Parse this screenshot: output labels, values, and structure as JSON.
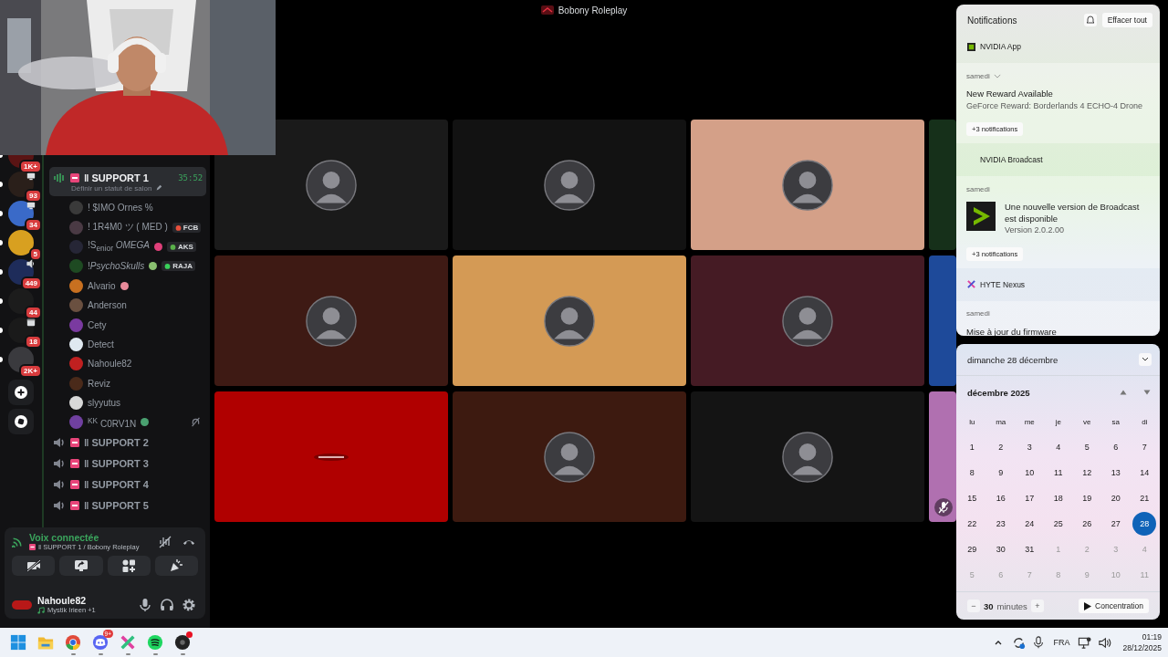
{
  "window": {
    "title": "Bobony Roleplay"
  },
  "servers": [
    {
      "badge": "1K+",
      "unread": true,
      "color": "#5a1414"
    },
    {
      "badge": "93",
      "unread": true,
      "color": "#2a1f1a",
      "activity": {
        "kind": "screen"
      }
    },
    {
      "badge": "34",
      "unread": true,
      "color": "#3a6ac8",
      "activity": {
        "kind": "screen"
      }
    },
    {
      "badge": "5",
      "unread": true,
      "color": "#d8a020"
    },
    {
      "badge": "449",
      "unread": true,
      "color": "#1e2c5a",
      "activity": {
        "kind": "voice"
      }
    },
    {
      "badge": "44",
      "unread": true,
      "color": "#1c1c1c"
    },
    {
      "badge": "18",
      "unread": true,
      "color": "#1a1a1a",
      "activity": {
        "kind": "event"
      }
    },
    {
      "badge": "2K+",
      "unread": true,
      "color": "#3a3a3e"
    }
  ],
  "channels": [
    {
      "name": "ǁ SUPPORT 1",
      "selected": true,
      "timer": "35:52",
      "status": "Définir un statut de salon",
      "members": [
        {
          "name": "! $IMO Ornes %",
          "color": "#3a3a3a",
          "deafened": false
        },
        {
          "name": "! 1R4M0 ツ ( MED )",
          "color": "#4a3a44",
          "deafened": false,
          "tag": {
            "label": "FCB",
            "color": "#e8503c"
          }
        },
        {
          "name": "!S$_{enior}$ *OMEGA*",
          "color": "#262636",
          "deafened": false,
          "emoji": {
            "kind": "question"
          },
          "tag": {
            "label": "AKS",
            "color": "#5ab04a"
          }
        },
        {
          "name": "!*PsychoSkulls*",
          "color": "#1e4a22",
          "deafened": false,
          "emoji": {
            "kind": "alien"
          },
          "tag": {
            "label": "RAJA",
            "color": "#3ad05a"
          }
        },
        {
          "name": "Alvario",
          "color": "#c87020",
          "deafened": false,
          "emoji": {
            "kind": "pig"
          }
        },
        {
          "name": "Anderson",
          "color": "#6a5040",
          "deafened": false
        },
        {
          "name": "Cety",
          "color": "#7a3aa0",
          "deafened": false
        },
        {
          "name": "Detect",
          "color": "#dfe8f0",
          "deafened": false
        },
        {
          "name": "Nahoule82",
          "color": "#c02020",
          "deafened": false
        },
        {
          "name": "Reviz",
          "color": "#4a2a1a",
          "deafened": false
        },
        {
          "name": "slyyutus",
          "color": "#d8d8d8",
          "deafened": false
        },
        {
          "name": "$^{KK}$ C0RV1N",
          "color": "#7040a0",
          "deafened": true,
          "emoji": {
            "kind": "dragon"
          }
        }
      ]
    },
    {
      "name": "ǁ SUPPORT 2",
      "selected": false
    },
    {
      "name": "ǁ SUPPORT 3",
      "selected": false
    },
    {
      "name": "ǁ SUPPORT 4",
      "selected": false
    },
    {
      "name": "ǁ SUPPORT 5",
      "selected": false
    }
  ],
  "voice": {
    "status": "Voix connectée",
    "channel": "ǁ SUPPORT 1 / Bobony Roleplay"
  },
  "user": {
    "name": "Nahoule82",
    "activity": "Mystik Irieen +1"
  },
  "tiles": [
    {
      "color": "#1a1a1a",
      "kind": "avatar",
      "muted": false
    },
    {
      "color": "#121212",
      "kind": "avatar",
      "muted": false
    },
    {
      "color": "#d4a088",
      "kind": "avatar",
      "muted": false
    },
    {
      "color": "#16301a",
      "kind": "blank",
      "muted": false
    },
    {
      "color": "#3e1a14",
      "kind": "avatar",
      "muted": false
    },
    {
      "color": "#d49a55",
      "kind": "avatar",
      "muted": false
    },
    {
      "color": "#451b24",
      "kind": "avatar",
      "muted": false
    },
    {
      "color": "#1e4a9a",
      "kind": "blank",
      "muted": false
    },
    {
      "color": "#b00000",
      "kind": "logo",
      "muted": false
    },
    {
      "color": "#3d1a10",
      "kind": "avatar",
      "muted": false
    },
    {
      "color": "#141414",
      "kind": "avatar",
      "muted": false
    },
    {
      "color": "#b070b0",
      "kind": "blank",
      "muted": true
    }
  ],
  "notifications": {
    "title": "Notifications",
    "clear": "Effacer tout",
    "groups": [
      {
        "app": "NVIDIA App",
        "kind": "nvidia",
        "items": [
          {
            "day": "samedi",
            "expandable": true,
            "title": "New Reward Available",
            "body": "GeForce Reward: Borderlands 4 ECHO-4 Drone",
            "image": false
          }
        ],
        "more": "+3 notifications"
      },
      {
        "app": "NVIDIA Broadcast",
        "kind": "broadcast",
        "items": [
          {
            "day": "samedi",
            "expandable": false,
            "title": "Une nouvelle version de Broadcast est disponible",
            "body": "Version 2.0.2.00",
            "image": true
          }
        ],
        "more": "+3 notifications"
      },
      {
        "app": "HYTE Nexus",
        "kind": "hyte",
        "items": [
          {
            "day": "samedi",
            "expandable": false,
            "title": "Mise à jour du firmware",
            "image": false
          }
        ]
      }
    ]
  },
  "calendar": {
    "date": "dimanche 28 décembre",
    "month": "décembre 2025",
    "weekdays": [
      "lu",
      "ma",
      "me",
      "je",
      "ve",
      "sa",
      "di"
    ],
    "days": [
      {
        "label": "1",
        "outside": false,
        "selected": false
      },
      {
        "label": "2",
        "outside": false,
        "selected": false
      },
      {
        "label": "3",
        "outside": false,
        "selected": false
      },
      {
        "label": "4",
        "outside": false,
        "selected": false
      },
      {
        "label": "5",
        "outside": false,
        "selected": false
      },
      {
        "label": "6",
        "outside": false,
        "selected": false
      },
      {
        "label": "7",
        "outside": false,
        "selected": false
      },
      {
        "label": "8",
        "outside": false,
        "selected": false
      },
      {
        "label": "9",
        "outside": false,
        "selected": false
      },
      {
        "label": "10",
        "outside": false,
        "selected": false
      },
      {
        "label": "11",
        "outside": false,
        "selected": false
      },
      {
        "label": "12",
        "outside": false,
        "selected": false
      },
      {
        "label": "13",
        "outside": false,
        "selected": false
      },
      {
        "label": "14",
        "outside": false,
        "selected": false
      },
      {
        "label": "15",
        "outside": false,
        "selected": false
      },
      {
        "label": "16",
        "outside": false,
        "selected": false
      },
      {
        "label": "17",
        "outside": false,
        "selected": false
      },
      {
        "label": "18",
        "outside": false,
        "selected": false
      },
      {
        "label": "19",
        "outside": false,
        "selected": false
      },
      {
        "label": "20",
        "outside": false,
        "selected": false
      },
      {
        "label": "21",
        "outside": false,
        "selected": false
      },
      {
        "label": "22",
        "outside": false,
        "selected": false
      },
      {
        "label": "23",
        "outside": false,
        "selected": false
      },
      {
        "label": "24",
        "outside": false,
        "selected": false
      },
      {
        "label": "25",
        "outside": false,
        "selected": false
      },
      {
        "label": "26",
        "outside": false,
        "selected": false
      },
      {
        "label": "27",
        "outside": false,
        "selected": false
      },
      {
        "label": "28",
        "outside": false,
        "selected": true
      },
      {
        "label": "29",
        "outside": false,
        "selected": false
      },
      {
        "label": "30",
        "outside": false,
        "selected": false
      },
      {
        "label": "31",
        "outside": false,
        "selected": false
      },
      {
        "label": "1",
        "outside": true,
        "selected": false
      },
      {
        "label": "2",
        "outside": true,
        "selected": false
      },
      {
        "label": "3",
        "outside": true,
        "selected": false
      },
      {
        "label": "4",
        "outside": true,
        "selected": false
      },
      {
        "label": "5",
        "outside": true,
        "selected": false
      },
      {
        "label": "6",
        "outside": true,
        "selected": false
      },
      {
        "label": "7",
        "outside": true,
        "selected": false
      },
      {
        "label": "8",
        "outside": true,
        "selected": false
      },
      {
        "label": "9",
        "outside": true,
        "selected": false
      },
      {
        "label": "10",
        "outside": true,
        "selected": false
      },
      {
        "label": "11",
        "outside": true,
        "selected": false
      }
    ],
    "focus": {
      "decrease": "−",
      "minutes": "30",
      "unit": "minutes",
      "increase": "+",
      "start": "Concentration"
    }
  },
  "taskbar": {
    "apps": [
      {
        "kind": "start",
        "running": false
      },
      {
        "kind": "explorer",
        "running": false
      },
      {
        "kind": "chrome",
        "running": true
      },
      {
        "kind": "discord",
        "running": true,
        "badge": "9+"
      },
      {
        "kind": "hyte",
        "running": true
      },
      {
        "kind": "spotify",
        "running": true
      },
      {
        "kind": "disc",
        "running": true,
        "alert": true
      }
    ],
    "language": "FRA",
    "time": "01:19",
    "date": "28/12/2025"
  }
}
